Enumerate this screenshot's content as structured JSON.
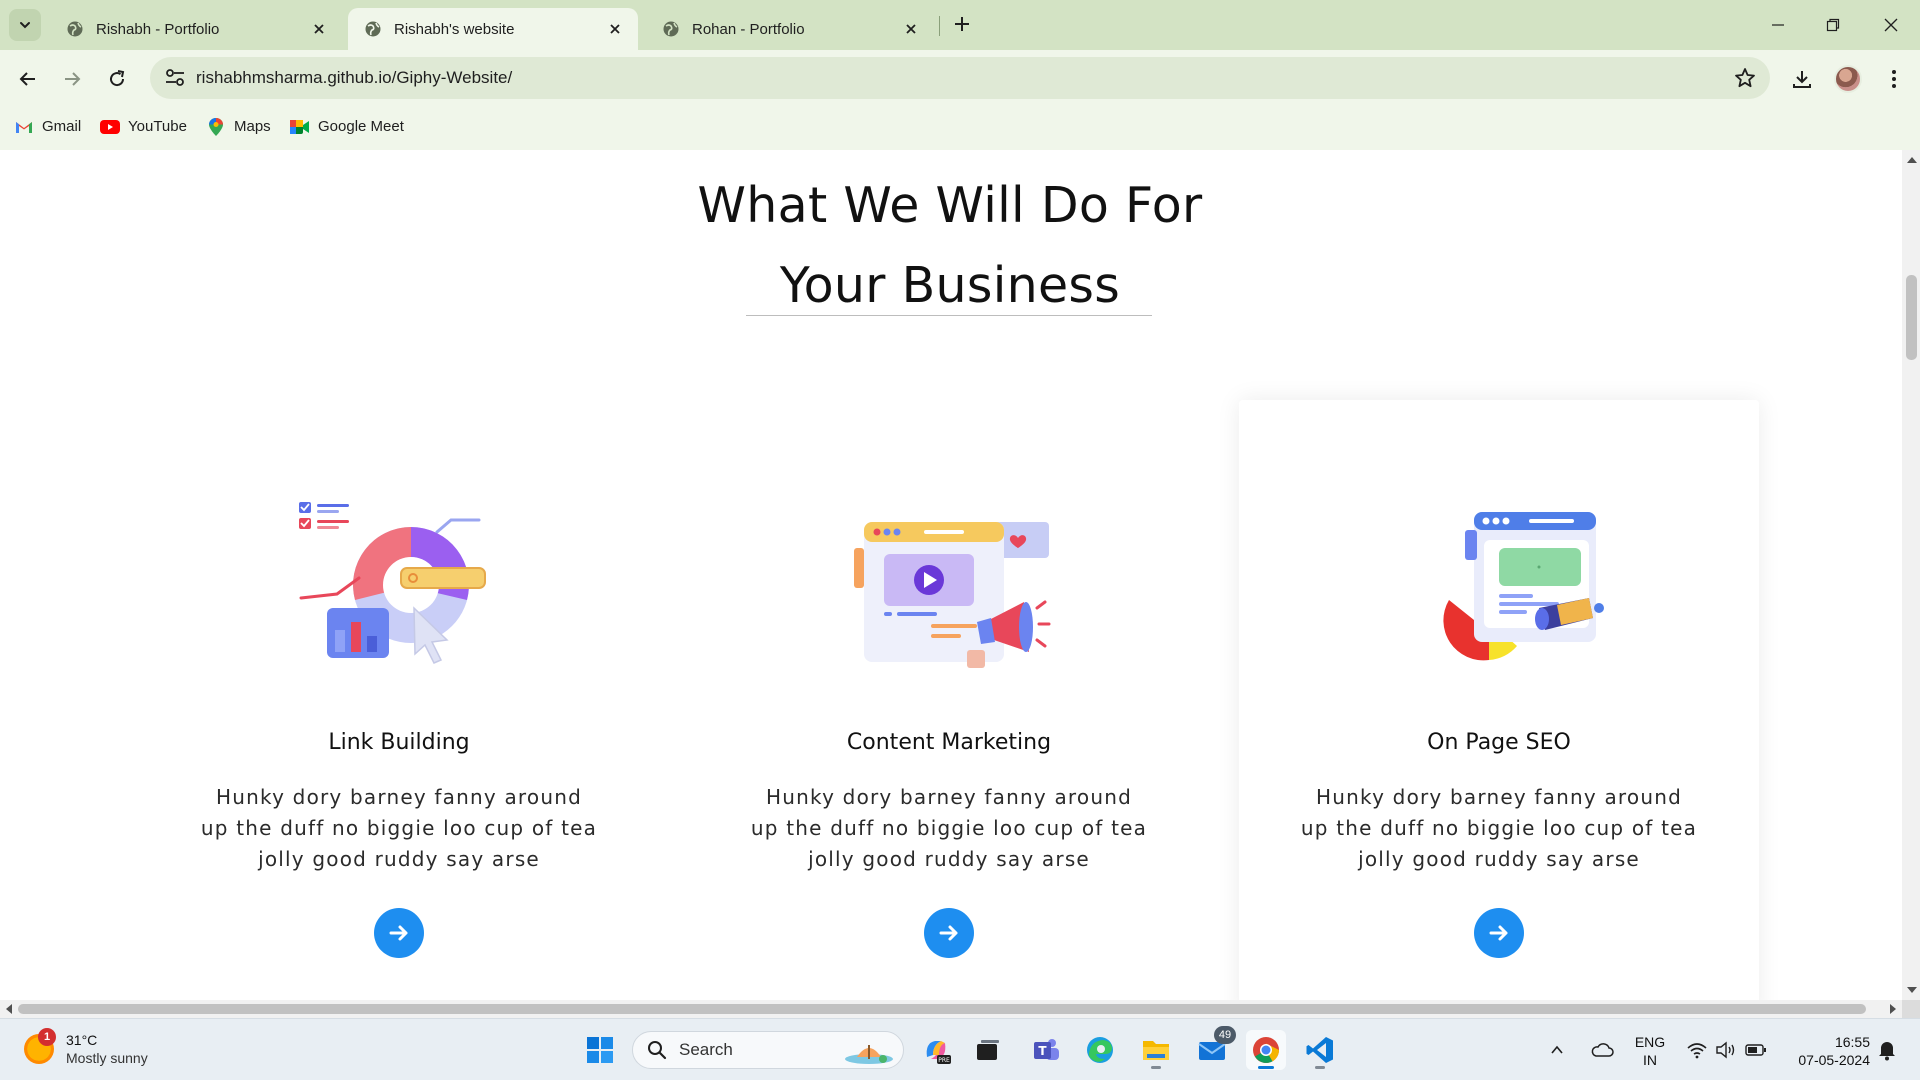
{
  "browser": {
    "tabs": [
      {
        "title": "Rishabh - Portfolio",
        "active": false
      },
      {
        "title": "Rishabh's website",
        "active": true
      },
      {
        "title": "Rohan - Portfolio",
        "active": false
      }
    ],
    "url": "rishabhmsharma.github.io/Giphy-Website/",
    "bookmarks": [
      {
        "label": "Gmail",
        "icon": "gmail-icon"
      },
      {
        "label": "YouTube",
        "icon": "youtube-icon"
      },
      {
        "label": "Maps",
        "icon": "maps-icon"
      },
      {
        "label": "Google Meet",
        "icon": "google-meet-icon"
      }
    ]
  },
  "page": {
    "heading_line1": "What We Will Do For",
    "heading_line2": "Your Business",
    "accent_color": "#1e8ef0",
    "services": [
      {
        "title": "Link Building",
        "text": "Hunky dory barney fanny around up the duff no biggie loo cup of tea jolly good ruddy say arse",
        "illustration": "donut-chart-analytics-illustration"
      },
      {
        "title": "Content Marketing",
        "text": "Hunky dory barney fanny around up the duff no biggie loo cup of tea jolly good ruddy say arse",
        "illustration": "video-megaphone-illustration"
      },
      {
        "title": "On Page SEO",
        "text": "Hunky dory barney fanny around up the duff no biggie loo cup of tea jolly good ruddy say arse",
        "illustration": "browser-telescope-illustration"
      }
    ]
  },
  "taskbar": {
    "weather_badge": "1",
    "temperature": "31°C",
    "condition": "Mostly sunny",
    "search_label": "Search",
    "mail_badge": "49",
    "language": "ENG",
    "region": "IN",
    "time": "16:55",
    "date": "07-05-2024"
  }
}
